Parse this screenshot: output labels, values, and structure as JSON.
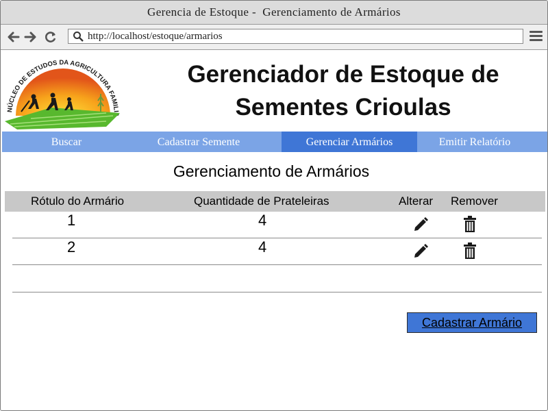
{
  "browser": {
    "window_title": "Gerencia de Estoque -  Gerenciamento de Armários",
    "url": "http://localhost/estoque/armarios"
  },
  "header": {
    "logo_text": "NÚCLEO DE ESTUDOS DA AGRICULTURA FAMILIAR",
    "title_line1": "Gerenciador de Estoque de",
    "title_line2": "Sementes Crioulas"
  },
  "menu": {
    "items": [
      {
        "label": "Buscar"
      },
      {
        "label": "Cadastrar Semente"
      },
      {
        "label": "Gerenciar Armários",
        "active": true
      },
      {
        "label": "Emitir Relatório"
      }
    ],
    "active_color": "#3f76d6",
    "bar_color": "#7ba4e6"
  },
  "main": {
    "title": "Gerenciamento de Armários",
    "table": {
      "headers": [
        "Rótulo do Armário",
        "Quantidade de Prateleiras",
        "Alterar",
        "Remover"
      ],
      "rows": [
        {
          "label": "1",
          "shelves": "4"
        },
        {
          "label": "2",
          "shelves": "4"
        }
      ]
    },
    "add_button_label": "Cadastrar Armário"
  }
}
